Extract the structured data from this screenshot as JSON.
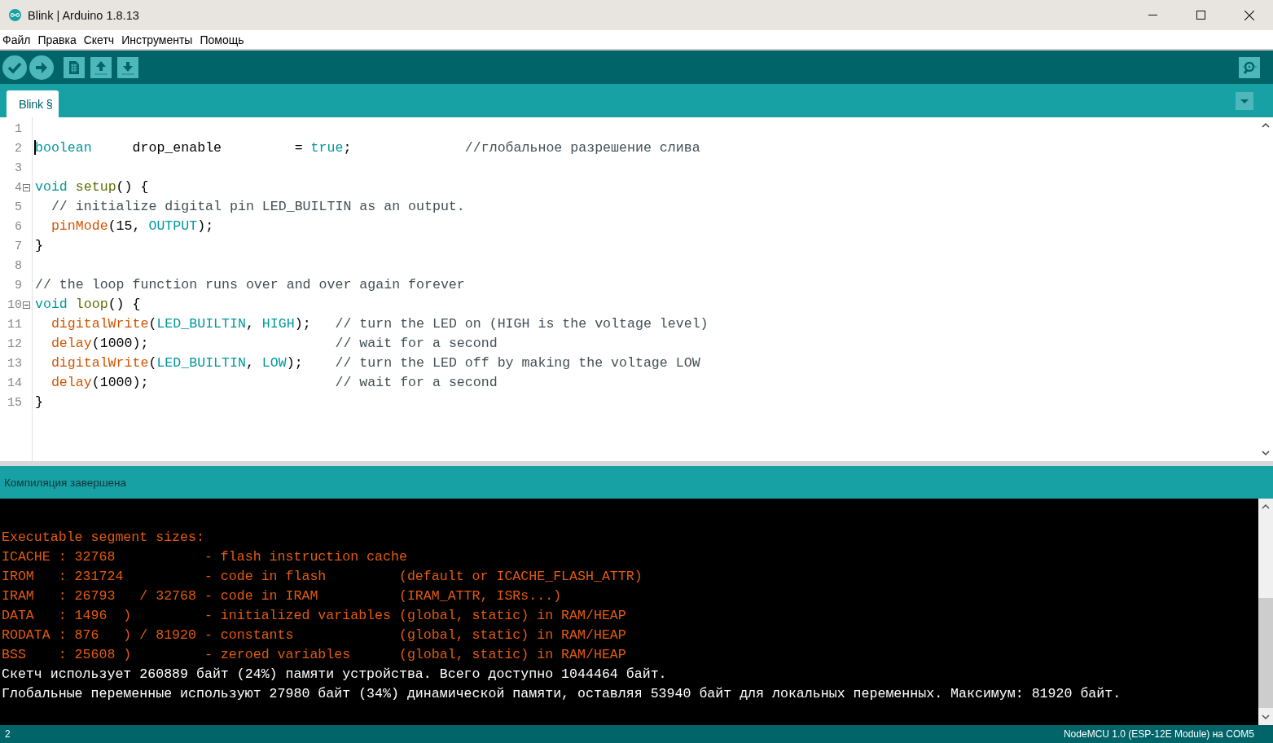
{
  "window": {
    "title": "Blink | Arduino 1.8.13"
  },
  "menu": [
    "Файл",
    "Правка",
    "Скетч",
    "Инструменты",
    "Помощь"
  ],
  "tabs": [
    {
      "label": "Blink §",
      "selected": true
    }
  ],
  "editor": {
    "lines": [
      {
        "number": "1",
        "fold": false
      },
      {
        "number": "2",
        "fold": false,
        "tokens": [
          {
            "kind": "type",
            "text": "boolean"
          },
          {
            "kind": "plain",
            "text": "     drop_enable         = "
          },
          {
            "kind": "constant",
            "text": "true"
          },
          {
            "kind": "plain",
            "text": ";              "
          },
          {
            "kind": "comment",
            "text": "//глобальное разрешение слива"
          }
        ]
      },
      {
        "number": "3",
        "fold": false
      },
      {
        "number": "4",
        "fold": true,
        "tokens": [
          {
            "kind": "type",
            "text": "void "
          },
          {
            "kind": "structure",
            "text": "setup"
          },
          {
            "kind": "plain",
            "text": "() {"
          }
        ]
      },
      {
        "number": "5",
        "fold": false,
        "tokens": [
          {
            "kind": "comment",
            "text": "  // initialize digital pin LED_BUILTIN as an output."
          }
        ]
      },
      {
        "number": "6",
        "fold": false,
        "tokens": [
          {
            "kind": "function",
            "text": "  pinMode"
          },
          {
            "kind": "plain",
            "text": "(15, "
          },
          {
            "kind": "constant",
            "text": "OUTPUT"
          },
          {
            "kind": "plain",
            "text": ");"
          }
        ]
      },
      {
        "number": "7",
        "fold": false,
        "tokens": [
          {
            "kind": "plain",
            "text": "}"
          }
        ]
      },
      {
        "number": "8",
        "fold": false
      },
      {
        "number": "9",
        "fold": false,
        "tokens": [
          {
            "kind": "comment",
            "text": "// the loop function runs over and over again forever"
          }
        ]
      },
      {
        "number": "10",
        "fold": true,
        "tokens": [
          {
            "kind": "type",
            "text": "void "
          },
          {
            "kind": "structure",
            "text": "loop"
          },
          {
            "kind": "plain",
            "text": "() {"
          }
        ]
      },
      {
        "number": "11",
        "fold": false,
        "tokens": [
          {
            "kind": "function",
            "text": "  digitalWrite"
          },
          {
            "kind": "plain",
            "text": "("
          },
          {
            "kind": "constant",
            "text": "LED_BUILTIN"
          },
          {
            "kind": "plain",
            "text": ", "
          },
          {
            "kind": "constant",
            "text": "HIGH"
          },
          {
            "kind": "plain",
            "text": ");   "
          },
          {
            "kind": "comment",
            "text": "// turn the LED on (HIGH is the voltage level)"
          }
        ]
      },
      {
        "number": "12",
        "fold": false,
        "tokens": [
          {
            "kind": "function",
            "text": "  delay"
          },
          {
            "kind": "plain",
            "text": "(1000);                       "
          },
          {
            "kind": "comment",
            "text": "// wait for a second"
          }
        ]
      },
      {
        "number": "13",
        "fold": false,
        "tokens": [
          {
            "kind": "function",
            "text": "  digitalWrite"
          },
          {
            "kind": "plain",
            "text": "("
          },
          {
            "kind": "constant",
            "text": "LED_BUILTIN"
          },
          {
            "kind": "plain",
            "text": ", "
          },
          {
            "kind": "constant",
            "text": "LOW"
          },
          {
            "kind": "plain",
            "text": ");    "
          },
          {
            "kind": "comment",
            "text": "// turn the LED off by making the voltage LOW"
          }
        ]
      },
      {
        "number": "14",
        "fold": false,
        "tokens": [
          {
            "kind": "function",
            "text": "  delay"
          },
          {
            "kind": "plain",
            "text": "(1000);                       "
          },
          {
            "kind": "comment",
            "text": "// wait for a second"
          }
        ]
      },
      {
        "number": "15",
        "fold": false,
        "tokens": [
          {
            "kind": "plain",
            "text": "}"
          }
        ]
      }
    ]
  },
  "console": {
    "status": "Компиляция завершена",
    "lines": [
      {
        "kind": "stderr",
        "text": "Executable segment sizes:"
      },
      {
        "kind": "stderr",
        "text": "ICACHE : 32768           - flash instruction cache"
      },
      {
        "kind": "stderr",
        "text": "IROM   : 231724          - code in flash         (default or ICACHE_FLASH_ATTR)"
      },
      {
        "kind": "stderr",
        "text": "IRAM   : 26793   / 32768 - code in IRAM          (IRAM_ATTR, ISRs...)"
      },
      {
        "kind": "stderr",
        "text": "DATA   : 1496  )         - initialized variables (global, static) in RAM/HEAP"
      },
      {
        "kind": "stderr",
        "text": "RODATA : 876   ) / 81920 - constants             (global, static) in RAM/HEAP"
      },
      {
        "kind": "stderr",
        "text": "BSS    : 25608 )         - zeroed variables      (global, static) in RAM/HEAP"
      },
      {
        "kind": "stdout",
        "text": "Скетч использует 260889 байт (24%) памяти устройства. Всего доступно 1044464 байт."
      },
      {
        "kind": "stdout",
        "text": "Глобальные переменные используют 27980 байт (34%) динамической памяти, оставляя 53940 байт для локальных переменных. Максимум: 81920 байт."
      }
    ]
  },
  "status_bar": {
    "line": "2",
    "board": "NodeMCU 1.0 (ESP-12E Module) на COM5"
  }
}
